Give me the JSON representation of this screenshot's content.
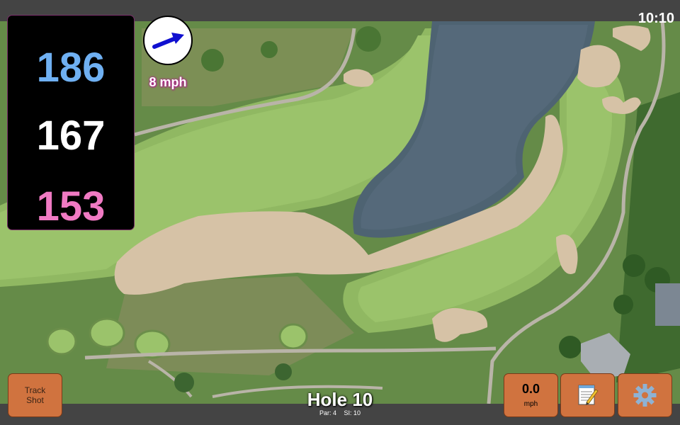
{
  "status_bar": {
    "time": "10:10"
  },
  "distances": {
    "back": "186",
    "middle": "167",
    "front": "153"
  },
  "wind": {
    "speed_label": "8 mph",
    "icon": "arrow-icon"
  },
  "buttons": {
    "track_shot_line1": "Track",
    "track_shot_line2": "Shot",
    "speed_value": "0.0",
    "speed_unit": "mph",
    "notes_icon": "notepad-icon",
    "settings_icon": "gear-icon"
  },
  "hole": {
    "title": "Hole 10",
    "par": "Par: 4",
    "si": "SI: 10"
  },
  "colors": {
    "back_distance": "#6fb0f2",
    "middle_distance": "#ffffff",
    "front_distance": "#f07ac3",
    "button_fill": "#d0733f",
    "panel_bg": "#000000"
  }
}
